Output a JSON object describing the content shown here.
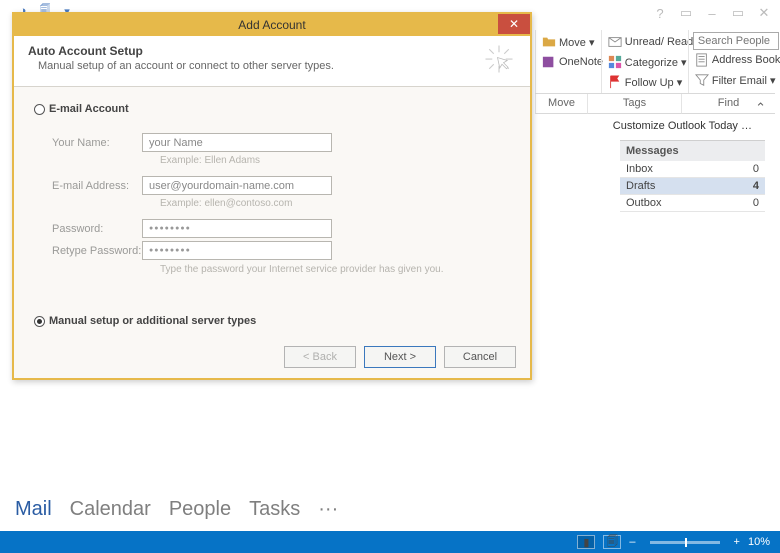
{
  "window": {
    "help": "?",
    "min": "–",
    "max": "▭",
    "close": "✕"
  },
  "ribbon": {
    "move": {
      "label": "Move ▾",
      "onenote": "OneNote",
      "group": "Move"
    },
    "tags": {
      "unread": "Unread/ Read",
      "cat": "Categorize ▾",
      "follow": "Follow Up ▾",
      "group": "Tags"
    },
    "find": {
      "search_placeholder": "Search People",
      "addr": "Address Book",
      "filter": "Filter Email ▾",
      "group": "Find"
    }
  },
  "customize": "Customize Outlook Today  …",
  "messages": {
    "header": "Messages",
    "rows": [
      {
        "name": "Inbox",
        "count": "0"
      },
      {
        "name": "Drafts",
        "count": "4"
      },
      {
        "name": "Outbox",
        "count": "0"
      }
    ]
  },
  "dialog": {
    "title": "Add Account",
    "head_title": "Auto Account Setup",
    "head_sub": "Manual setup of an account or connect to other server types.",
    "opt_email": "E-mail Account",
    "opt_manual": "Manual setup or additional server types",
    "fields": {
      "name_label": "Your Name:",
      "name_value": "your Name",
      "name_example": "Example: Ellen Adams",
      "email_label": "E-mail Address:",
      "email_value": "user@yourdomain-name.com",
      "email_example": "Example: ellen@contoso.com",
      "pw_label": "Password:",
      "pw_value": "●●●●●●●●",
      "pw2_label": "Retype Password:",
      "pw2_value": "●●●●●●●●",
      "pw_hint": "Type the password your Internet service provider has given you."
    },
    "buttons": {
      "back": "< Back",
      "next": "Next >",
      "cancel": "Cancel"
    }
  },
  "bottom": {
    "mail": "Mail",
    "calendar": "Calendar",
    "people": "People",
    "tasks": "Tasks",
    "more": "···"
  },
  "status": {
    "zoom": "10%",
    "minus": "–",
    "plus": "+"
  }
}
